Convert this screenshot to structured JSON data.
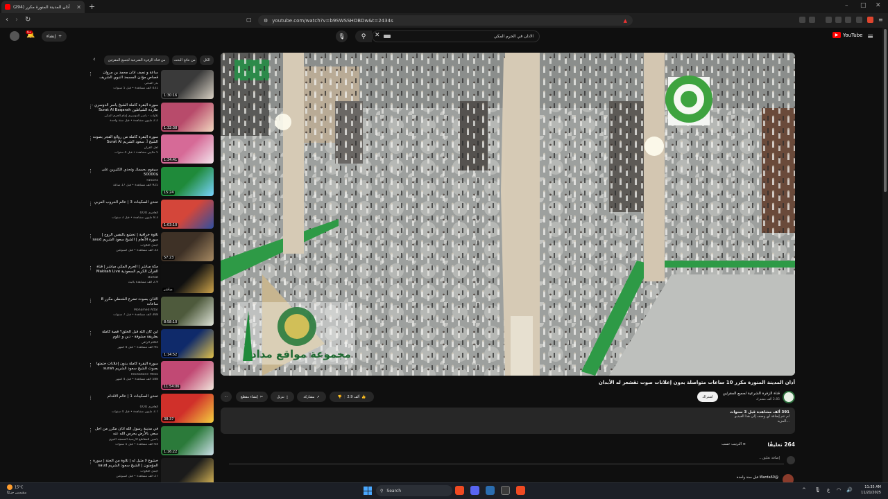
{
  "browser": {
    "tab_title": "(294) أذان المدينة المنورة مكرر",
    "new_tab": "+",
    "url": "youtube.com/watch?v=b9SWSSHOBDw&t=2434s",
    "min": "–",
    "max": "□",
    "close": "✕"
  },
  "youtube": {
    "search_query": "الاذان في الحرم المكي",
    "create_label": "إنشاء",
    "notifications_badge": "9+",
    "logo_text": "YouTube"
  },
  "chips": {
    "arrow": "‹",
    "items": [
      {
        "label": "الكل",
        "active": true
      },
      {
        "label": "من نتائج البحث",
        "active": false
      },
      {
        "label": "من قناة الزفرة الشرعية لجميع المقرئين",
        "active": false
      }
    ]
  },
  "sidebar": [
    {
      "title": "ساعة و نصف أذان محمد بن مروان قصاص مؤذن المسجد النبوي الشريف",
      "channel": "بدر المدني",
      "meta": "431 ألف مشاهدة • قبل 5 سنوات",
      "duration": "1:30:16",
      "thumb": [
        "#3a3a3a",
        "#d9d2c5"
      ]
    },
    {
      "title": "سورة البقرة كاملة الشيخ ياسر الدوسري - طاردة الشياطين Surat Al Baqarah",
      "channel": "تلاوات - ياسر الدوسري إمام الحرم المكي",
      "meta": "2.2 مليون مشاهدة • قبل سنة واحدة",
      "duration": "1:32:38",
      "thumb": [
        "#b84b6b",
        "#f1d8c0"
      ]
    },
    {
      "title": "سورة البقرة كاملة من روائع الفجر بصوت الشيخ أ. سعود الشريم Surat Al",
      "channel": "أهل القرآن",
      "meta": "5 ملايين مشاهدة • قبل 4 سنوات",
      "duration": "1:34:41",
      "thumb": [
        "#d66a97",
        "#f3e5ed"
      ]
    },
    {
      "title": "سيقوم بحبسك وتحدي الكثيرين على $50000",
      "channel": "Falcons",
      "meta": "925 ألف مشاهدة • قبل 17 ساعة",
      "duration": "15:24",
      "thumb": [
        "#1f8a3a",
        "#79d3ff"
      ]
    },
    {
      "title": "تحدي السكينات 3 | عالم الحروب العربي",
      "channel": "العافري OOO",
      "meta": "8.3 مليون مشاهدة • قبل 3 سنوات",
      "duration": "1:03:10",
      "thumb": [
        "#d4463a",
        "#2f4fa0"
      ]
    },
    {
      "title": "تلاوة خرافية | تخشع بالنفس الروح | سورة الأنعام | الشيخ سعود الشريم saud",
      "channel": "أجمل التلاوات",
      "meta": "33 ألف مشاهدة • قبل أسبوعين",
      "duration": "57:23",
      "thumb": [
        "#3e3126",
        "#a88b63"
      ]
    },
    {
      "title": "مكة مباشر | الحرم المكي مباشر | قناة القرآن الكريم السعودية Makkah Live",
      "channel": "Barkat",
      "meta": "2.9 ألف مشاهدة بالبث",
      "duration": "مباشر",
      "thumb": [
        "#101010",
        "#d0a54b"
      ]
    },
    {
      "title": "الأذان بصوت تضرع الشنطي مكرر 8 ساعات",
      "channel": "Mohamed Attar",
      "meta": "368 ألف مشاهدة • قبل 7 سنوات",
      "duration": "8:58:10",
      "thumb": [
        "#4e5a3c",
        "#dfe4d8"
      ]
    },
    {
      "title": "أين كان الله قبل الخلق؟ قصة كاملة بطريقة مشوقة - دين و علوم",
      "channel": "الكلام الراقي",
      "meta": "95 ألف مشاهدة • قبل 4 أشهر",
      "duration": "1:14:52",
      "thumb": [
        "#0f2a6a",
        "#e2c24a"
      ]
    },
    {
      "title": "سورة البقرة كاملة بدون إعلانات ختمتها بصوت الشيخ سعود الشريم surah",
      "channel": "Recitations' Mesk",
      "meta": "588 ألف مشاهدة • قبل 4 أشهر",
      "duration": "11:54:06",
      "thumb": [
        "#c14974",
        "#f0e6dc"
      ]
    },
    {
      "title": "تحدي السكينات 1 | عالم الأقدام",
      "channel": "العافري OOO",
      "meta": "3.7 مليون مشاهدة • قبل 4 سنوات",
      "duration": "38:37",
      "thumb": [
        "#d0302a",
        "#f4d03f"
      ]
    },
    {
      "title": "في مدينة رسول الله أذان مكرر من أجل سعي بالأرض يحرس الله عنه",
      "channel": "ياسين للمقاطع الأرضية المسجد النبوي",
      "meta": "64 ألف مشاهدة • قبل 5 سنوات",
      "duration": "1:16:22",
      "thumb": [
        "#2b7a3a",
        "#cde0ea"
      ]
    },
    {
      "title": "خشوع لا مثيل له | تلاوة من الجنة | سورة المؤمنون | الشيخ سعود الشريم saud",
      "channel": "أجمل التلاوات",
      "meta": "27 ألف مشاهدة • قبل أسبوعين",
      "duration": "",
      "thumb": [
        "#1b1b1b",
        "#e6c15a"
      ]
    }
  ],
  "video": {
    "title": "أذان المدينة المنورة مكرر 10 ساعات متواصلة بدون إعلانات صوت تقشعر له الأبدان",
    "logo_text": "مجموعة مواقع مداد",
    "channel_name": "قناة الزفرة الشرعية لجميع المقرئين",
    "channel_subs": "2.85 ألف مشترك",
    "subscribe_label": "اشتراك",
    "like_count": "2.9 ألف",
    "share_label": "مشاركة",
    "download_label": "تنزيل",
    "clip_label": "إنشاء مقطع",
    "more": "⋯"
  },
  "description": {
    "stats": "391 ألف مشاهدة قبل 3 سنوات",
    "line1": "لم تتم إضافة أي وصف إلى هذا الفيديو",
    "line2": "...المزيد"
  },
  "comments": {
    "count": "264 تعليقًا",
    "sort_label": "الترتيب حسب",
    "add_placeholder": "إضافة تعليق...",
    "first_author": "@Warda60 قبل سنة واحدة"
  },
  "taskbar": {
    "temp": "15°C",
    "weather": "مشمس جزئيًا",
    "search": "Search",
    "time": "11:35 AM",
    "date": "11/21/2025"
  }
}
